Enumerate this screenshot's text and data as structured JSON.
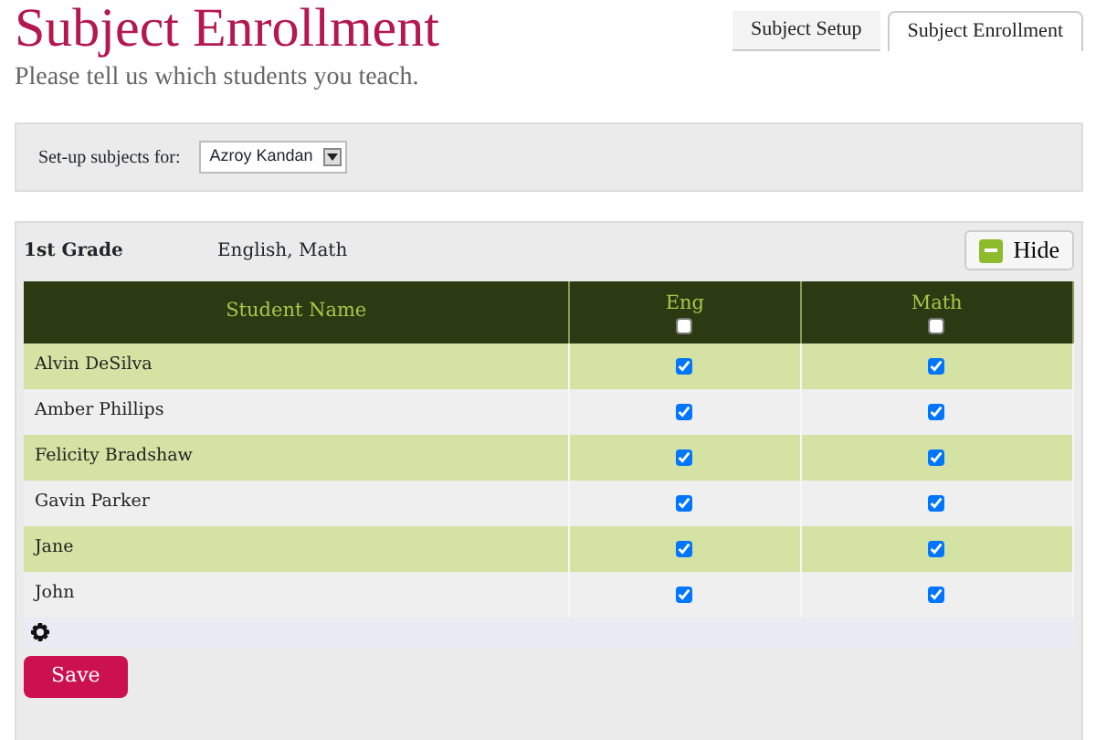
{
  "header": {
    "title": "Subject Enrollment",
    "subtitle": "Please tell us which students you teach."
  },
  "tabs": [
    {
      "label": "Subject Setup",
      "selected": false
    },
    {
      "label": "Subject Enrollment",
      "selected": true
    }
  ],
  "setup": {
    "label": "Set-up subjects for:",
    "teacher": "Azroy Kandan"
  },
  "grade": {
    "name": "1st Grade",
    "subjects": "English, Math",
    "hide_button": "Hide",
    "columns": [
      {
        "label": "Student Name"
      },
      {
        "label": "Eng",
        "checked": false
      },
      {
        "label": "Math",
        "checked": false
      }
    ],
    "rows": [
      {
        "name": "Alvin DeSilva",
        "eng": true,
        "math": true
      },
      {
        "name": "Amber Phillips",
        "eng": true,
        "math": true
      },
      {
        "name": "Felicity Bradshaw",
        "eng": true,
        "math": true
      },
      {
        "name": "Gavin Parker",
        "eng": true,
        "math": true
      },
      {
        "name": "Jane",
        "eng": true,
        "math": true
      },
      {
        "name": "John",
        "eng": true,
        "math": true
      }
    ]
  },
  "save_button": "Save"
}
